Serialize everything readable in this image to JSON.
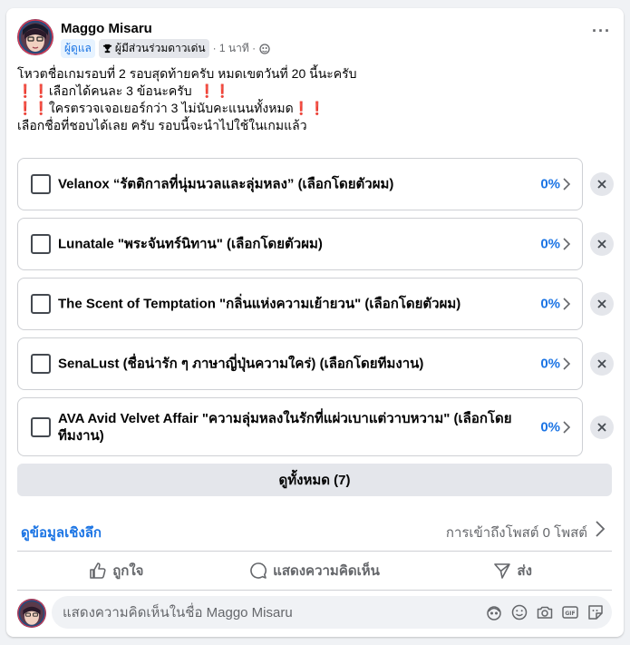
{
  "post": {
    "author": "Maggo Misaru",
    "role_badge": "ผู้ดูแล",
    "contributor_badge": "ผู้มีส่วนร่วมดาวเด่น",
    "time": "· 1 นาที ·",
    "more_icon": "more-horizontal-icon",
    "text_lines": [
      "โหวตชื่อเกมรอบที่ 2 รอบสุดท้ายครับ หมดเขตวันที่ 20 นี้นะครับ",
      "เลือกได้คนละ 3 ข้อนะครับ",
      "ใครตรวจเจอเยอร์กว่า 3 ไม่นับคะแนนทั้งหมด",
      "เลือกชื่อที่ชอบได้เลย ครับ  รอบนี้จะนำไปใช้ในเกมแล้ว"
    ],
    "emoji": "❗"
  },
  "poll": {
    "options": [
      {
        "label": "Velanox “รัตติกาลที่นุ่มนวลและลุ่มหลง” (เลือกโดยตัวผม)",
        "percent": "0%"
      },
      {
        "label": "Lunatale \"พระจันทร์นิทาน\" (เลือกโดยตัวผม)",
        "percent": "0%"
      },
      {
        "label": "The Scent of Temptation \"กลิ่นแห่งความเย้ายวน\" (เลือกโดยตัวผม)",
        "percent": "0%"
      },
      {
        "label": "SenaLust (ชื่อน่ารัก ๆ ภาษาญี่ปุ่นความใคร่) (เลือกโดยทีมงาน)",
        "percent": "0%"
      },
      {
        "label": "AVA Avid Velvet Affair \"ความลุ่มหลงในรักที่แผ่วเบาแต่วาบหวาม\" (เลือกโดยทีมงาน)",
        "percent": "0%"
      }
    ],
    "see_all": "ดูทั้งหมด (7)"
  },
  "insights": {
    "link": "ดูข้อมูลเชิงลึก",
    "reach": "การเข้าถึงโพสต์ 0 โพสต์"
  },
  "actions": {
    "like": "ถูกใจ",
    "comment": "แสดงความคิดเห็น",
    "share": "ส่ง"
  },
  "comment_box": {
    "placeholder": "แสดงความคิดเห็นในชื่อ Maggo Misaru",
    "icons": [
      "avatar-sticker-icon",
      "emoji-icon",
      "camera-icon",
      "gif-icon",
      "sticker-icon"
    ]
  },
  "colors": {
    "accent": "#1b74e4",
    "red": "#e41e3f",
    "muted": "#65676b"
  }
}
